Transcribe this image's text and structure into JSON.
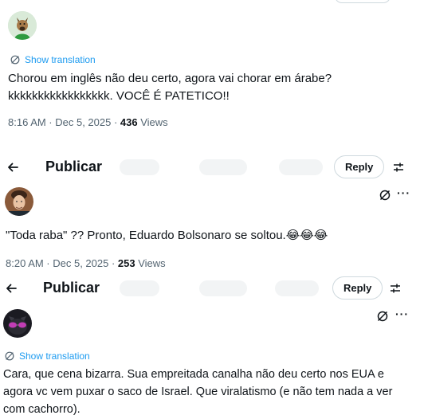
{
  "tweet1": {
    "translate_label": "Show translation",
    "text_line1": "Chorou em inglês não deu certo, agora vai chorar em árabe?",
    "text_line2": "kkkkkkkkkkkkkkkkk. VOCÊ É PATETICO!!",
    "time": "8:16 AM · Dec 5, 2025 · ",
    "views_count": "436",
    "views_label": " Views"
  },
  "bar1": {
    "title": "Publicar",
    "reply_label": "Reply"
  },
  "tweet2": {
    "text": "\"Toda raba\" ??  Pronto, Eduardo Bolsonaro se soltou.",
    "emoji": "😂😂😂",
    "time": "8:20 AM · Dec 5, 2025 · ",
    "views_count": "253",
    "views_label": " Views"
  },
  "bar2": {
    "title": "Publicar",
    "reply_label": "Reply"
  },
  "tweet3": {
    "translate_label": "Show translation",
    "text_line1": "Cara, que cena bizarra. Sua empreitada canalha não deu certo nos EUA e",
    "text_line2": "agora vc vem puxar o saco de Israel. Que viralatismo (e não tem nada a ver",
    "text_line3": "com cachorro)."
  },
  "icons": {
    "translate": "translate-icon",
    "back": "arrow-left-icon",
    "settings": "sliders-icon",
    "grok": "grok-icon",
    "more": "more-dots-icon"
  },
  "colors": {
    "link": "#1d9bf0",
    "muted": "#536471",
    "text": "#0f1419",
    "border": "#cfd9de"
  }
}
